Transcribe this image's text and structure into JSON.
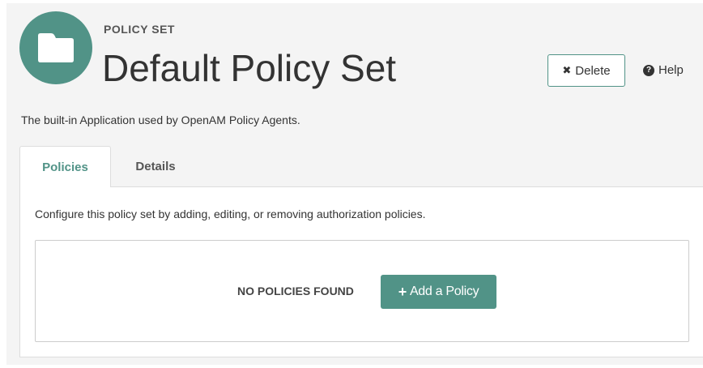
{
  "header": {
    "eyebrow": "POLICY SET",
    "title": "Default Policy Set",
    "icon": "folder-icon",
    "delete_label": "Delete",
    "help_label": "Help"
  },
  "description": "The built-in Application used by OpenAM Policy Agents.",
  "tabs": [
    {
      "label": "Policies",
      "active": true
    },
    {
      "label": "Details",
      "active": false
    }
  ],
  "panel": {
    "description": "Configure this policy set by adding, editing, or removing authorization policies.",
    "empty_text": "NO POLICIES FOUND",
    "add_label": "Add a Policy"
  },
  "colors": {
    "accent": "#519387",
    "background": "#f4f4f4",
    "panel": "#ffffff"
  }
}
